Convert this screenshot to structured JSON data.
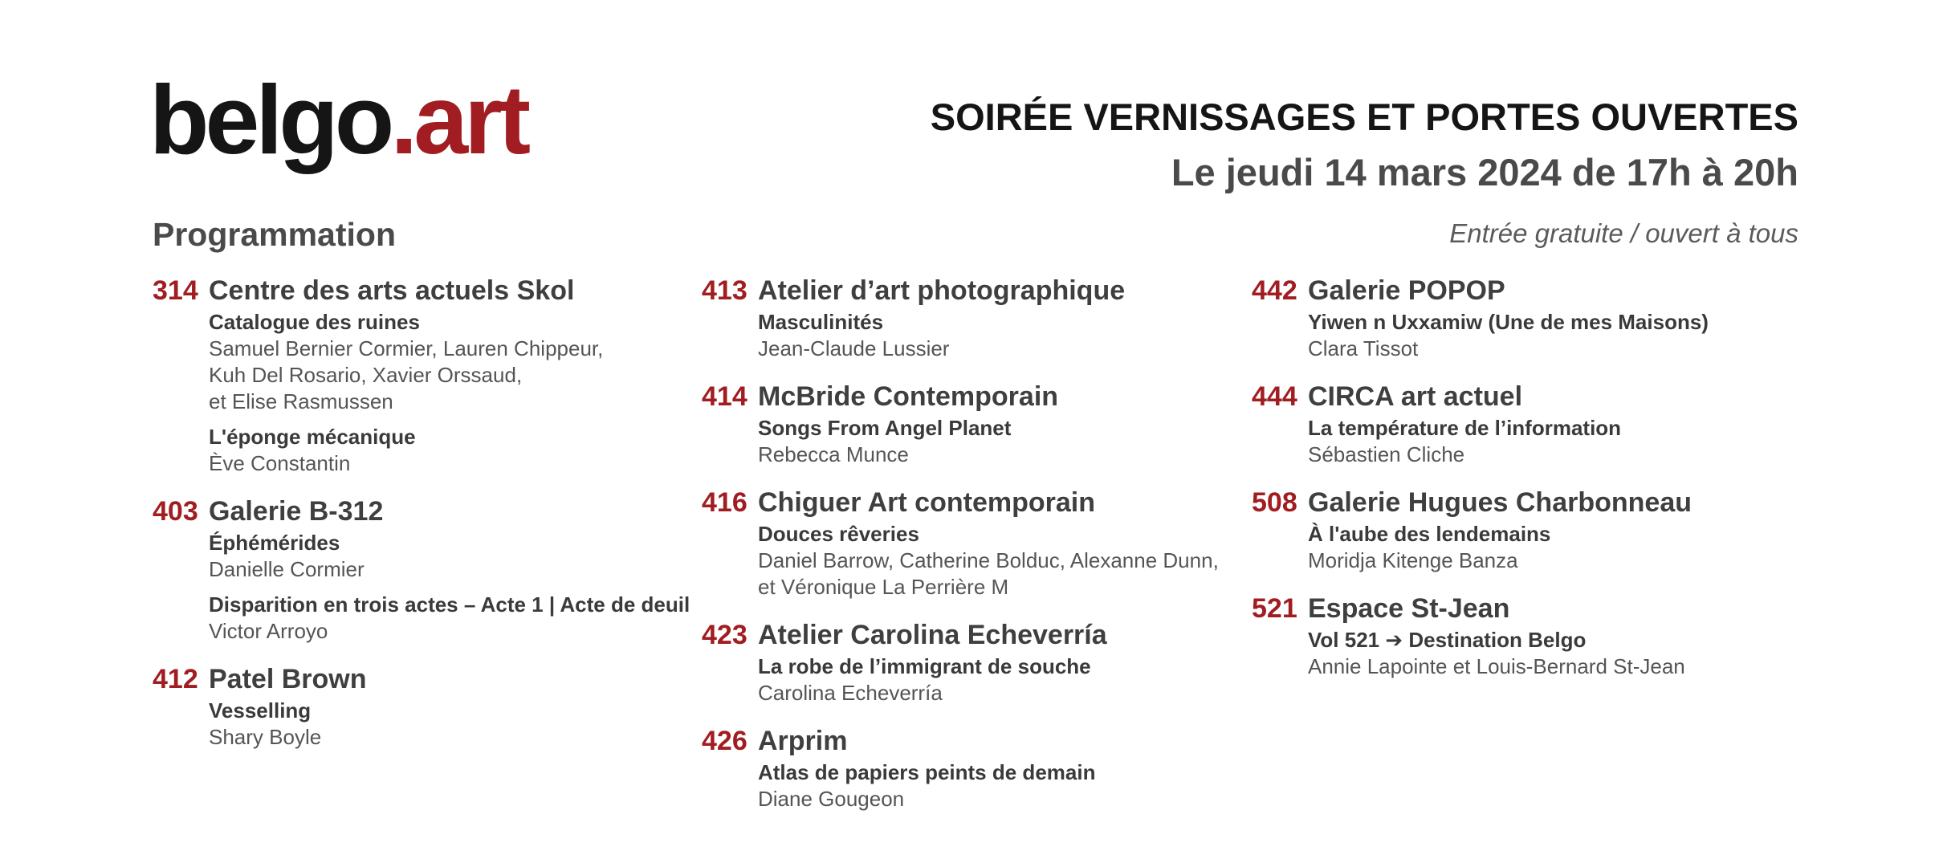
{
  "header": {
    "logo_main": "belgo",
    "logo_accent": ".art",
    "title": "SOIRÉE VERNISSAGES ET PORTES OUVERTES",
    "date": "Le jeudi 14 mars 2024 de 17h à 20h",
    "section_title": "Programmation",
    "entry_note": "Entrée gratuite / ouvert à tous"
  },
  "columns": [
    [
      {
        "number": "314",
        "name": "Centre des arts actuels Skol",
        "shows": [
          {
            "title": "Catalogue des ruines",
            "artists": [
              "Samuel Bernier Cormier, Lauren Chippeur,",
              "Kuh Del Rosario, Xavier Orssaud,",
              "et Elise Rasmussen"
            ]
          },
          {
            "title": "L'éponge mécanique",
            "artists": [
              "Ève Constantin"
            ]
          }
        ]
      },
      {
        "number": "403",
        "name": "Galerie B-312",
        "shows": [
          {
            "title": "Éphémérides",
            "artists": [
              "Danielle Cormier"
            ]
          },
          {
            "title": "Disparition en trois actes – Acte 1 | Acte de deuil",
            "artists": [
              "Victor Arroyo"
            ]
          }
        ]
      },
      {
        "number": "412",
        "name": "Patel Brown",
        "shows": [
          {
            "title": "Vesselling",
            "artists": [
              "Shary Boyle"
            ]
          }
        ]
      }
    ],
    [
      {
        "number": "413",
        "name": "Atelier d’art photographique",
        "shows": [
          {
            "title": "Masculinités",
            "artists": [
              "Jean-Claude Lussier"
            ]
          }
        ]
      },
      {
        "number": "414",
        "name": "McBride Contemporain",
        "shows": [
          {
            "title": "Songs From Angel Planet",
            "artists": [
              "Rebecca Munce"
            ]
          }
        ]
      },
      {
        "number": "416",
        "name": "Chiguer Art contemporain",
        "shows": [
          {
            "title": "Douces rêveries",
            "artists": [
              "Daniel Barrow, Catherine Bolduc, Alexanne Dunn,",
              "et Véronique La Perrière M"
            ]
          }
        ]
      },
      {
        "number": "423",
        "name": "Atelier Carolina Echeverría",
        "shows": [
          {
            "title": "La robe de l’immigrant de souche",
            "artists": [
              "Carolina Echeverría"
            ]
          }
        ]
      },
      {
        "number": "426",
        "name": "Arprim",
        "shows": [
          {
            "title": "Atlas de papiers peints de demain",
            "artists": [
              "Diane Gougeon"
            ]
          }
        ]
      }
    ],
    [
      {
        "number": "442",
        "name": "Galerie POPOP",
        "shows": [
          {
            "title": "Yiwen n Uxxamiw (Une de mes Maisons)",
            "artists": [
              "Clara Tissot"
            ]
          }
        ]
      },
      {
        "number": "444",
        "name": "CIRCA art actuel",
        "shows": [
          {
            "title": "La température de l’information",
            "artists": [
              "Sébastien Cliche"
            ]
          }
        ]
      },
      {
        "number": "508",
        "name": "Galerie Hugues Charbonneau",
        "shows": [
          {
            "title": "À l'aube des lendemains",
            "artists": [
              "Moridja Kitenge Banza"
            ]
          }
        ]
      },
      {
        "number": "521",
        "name": "Espace St-Jean",
        "shows": [
          {
            "title": "Vol 521 ➔ Destination Belgo",
            "artists": [
              "Annie Lapointe et Louis-Bernard St-Jean"
            ]
          }
        ]
      }
    ]
  ]
}
